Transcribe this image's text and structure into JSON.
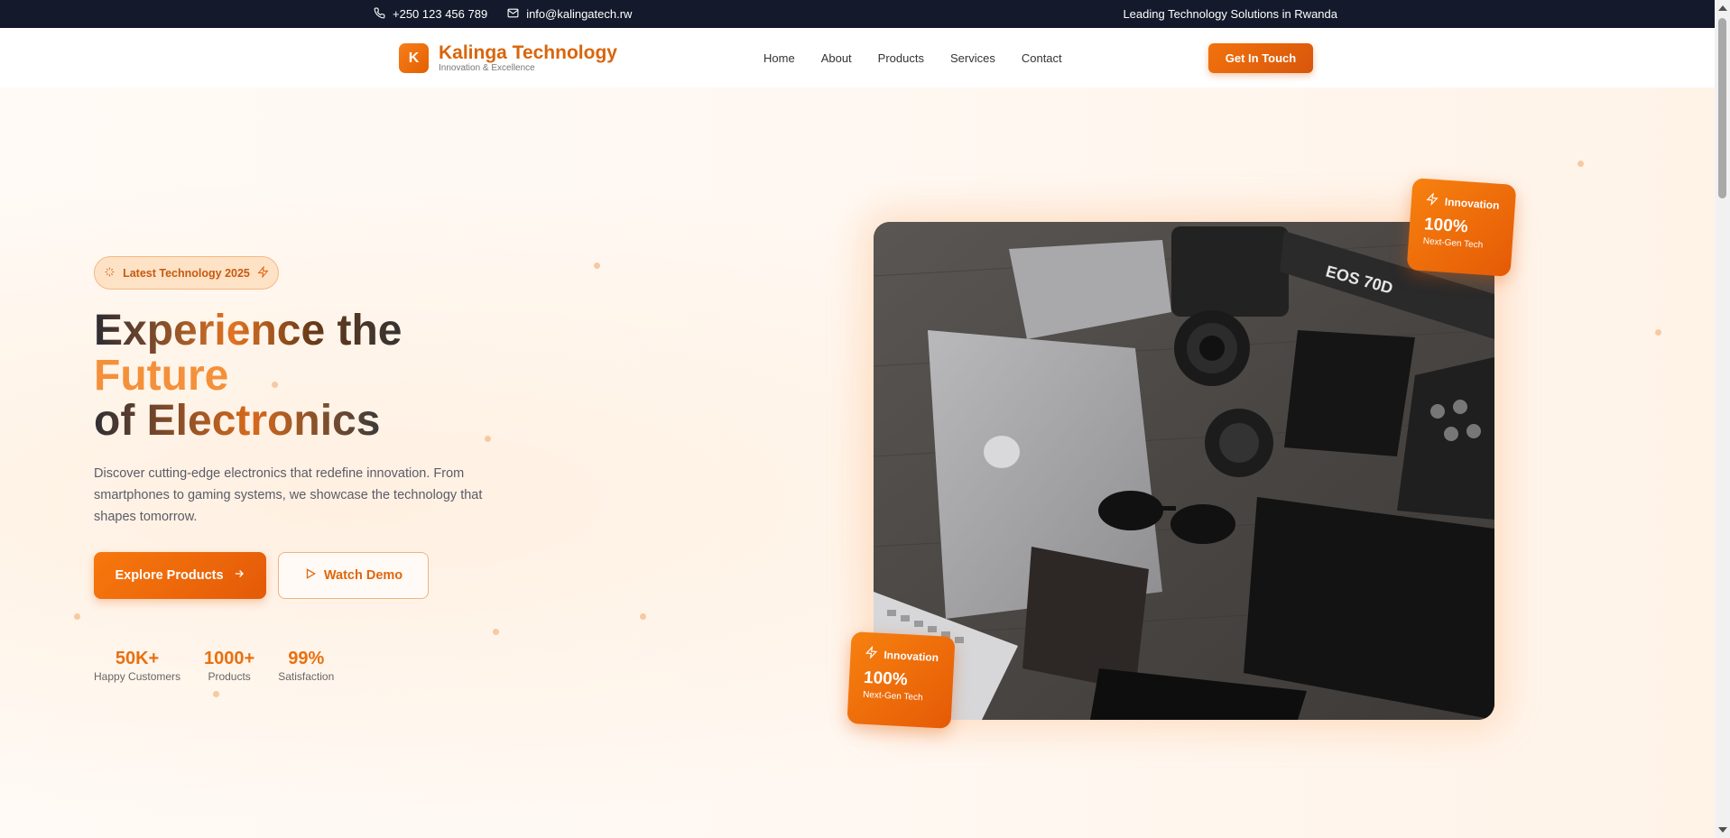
{
  "topbar": {
    "phone": "+250 123 456 789",
    "email": "info@kalingatech.rw",
    "tagline": "Leading Technology Solutions in Rwanda"
  },
  "brand": {
    "logo_letter": "K",
    "name": "Kalinga Technology",
    "subtitle": "Innovation & Excellence"
  },
  "nav": {
    "items": [
      "Home",
      "About",
      "Products",
      "Services",
      "Contact"
    ],
    "cta": "Get In Touch"
  },
  "hero": {
    "badge": "Latest Technology 2025",
    "headline": [
      "Experience the",
      "Future",
      "of Electronics"
    ],
    "description": "Discover cutting-edge electronics that redefine innovation. From smartphones to gaming systems, we showcase the technology that shapes tomorrow.",
    "primary_button": "Explore Products",
    "secondary_button": "Watch Demo",
    "stats": [
      {
        "value": "50K+",
        "label": "Happy Customers"
      },
      {
        "value": "1000+",
        "label": "Products"
      },
      {
        "value": "99%",
        "label": "Satisfaction"
      }
    ],
    "cards": [
      {
        "title": "Innovation",
        "value": "100%",
        "caption": "Next-Gen Tech"
      },
      {
        "title": "Innovation",
        "value": "100%",
        "caption": "Next-Gen Tech"
      }
    ],
    "photo_camera_text": "EOS 70D"
  },
  "colors": {
    "accent": "#f2720d",
    "topbar_bg": "#141a2b"
  },
  "icons": {
    "phone": "phone-icon",
    "email": "mail-icon",
    "badge": "sparkle-icon",
    "bolt": "lightning-icon",
    "arrow": "arrow-right-icon",
    "play": "play-icon"
  }
}
